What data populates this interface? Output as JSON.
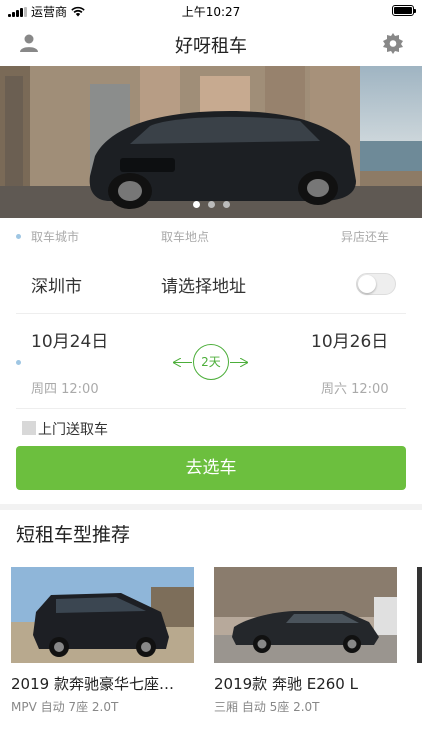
{
  "status_bar": {
    "carrier": "运营商",
    "time": "上午10:27"
  },
  "nav": {
    "title": "好呀租车",
    "left_icon": "user-icon",
    "right_icon": "gear-icon"
  },
  "banner": {
    "dots": 3,
    "active_dot": 0
  },
  "booking": {
    "labels": {
      "city": "取车城市",
      "location": "取车地点",
      "return": "异店还车"
    },
    "city": "深圳市",
    "address_placeholder": "请选择地址",
    "different_store_return": false,
    "pickup": {
      "date": "10月24日",
      "weekday_time": "周四 12:00"
    },
    "dropoff": {
      "date": "10月26日",
      "weekday_time": "周六 12:00"
    },
    "duration": "2天",
    "door_delivery": {
      "label": "上门送取车",
      "checked": false
    },
    "submit": "去选车"
  },
  "recommend": {
    "title": "短租车型推荐",
    "cars": [
      {
        "name": "2019 款奔驰豪华七座…",
        "spec": "MPV 自动 7座 2.0T"
      },
      {
        "name": "2019款 奔驰 E260 L",
        "spec": "三厢 自动 5座 2.0T"
      }
    ]
  },
  "colors": {
    "accent": "#6cbf3e",
    "muted": "#aaaaaa"
  }
}
